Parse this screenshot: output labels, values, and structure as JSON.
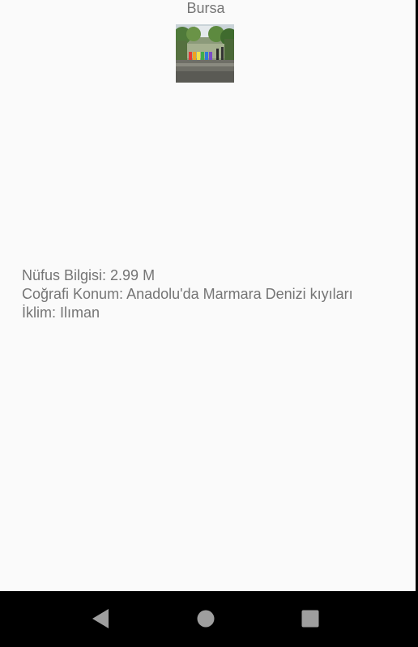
{
  "city": {
    "title": "Bursa",
    "photo_description_icon": "city-street-photo"
  },
  "info": {
    "population": "Nüfus Bilgisi: 2.99 M",
    "location": "Coğrafi Konum: Anadolu'da Marmara Denizi kıyıları",
    "climate": "İklim: Ilıman"
  },
  "navbar": {
    "back_icon": "back-triangle-icon",
    "home_icon": "home-circle-icon",
    "recents_icon": "recents-square-icon",
    "icon_color": "#9e9e9e"
  },
  "colors": {
    "background": "#fafafa",
    "text": "#757575",
    "navbar": "#000000"
  }
}
